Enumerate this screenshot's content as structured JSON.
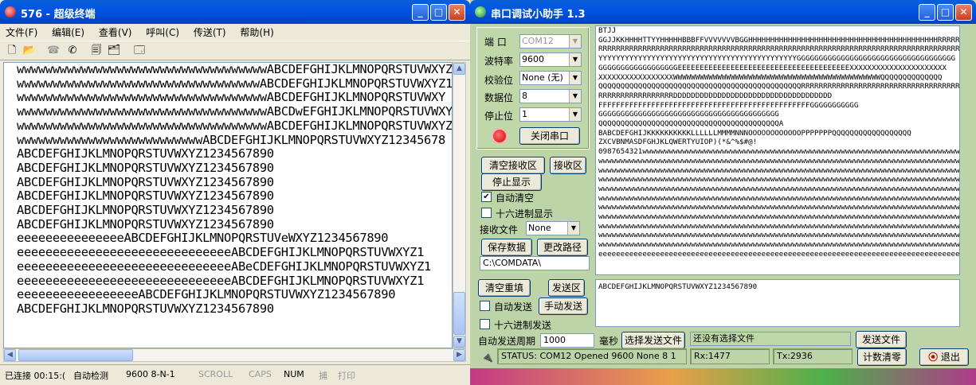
{
  "terminal": {
    "title": "576 - 超级终端",
    "menu": [
      "文件(F)",
      "编辑(E)",
      "查看(V)",
      "呼叫(C)",
      "传送(T)",
      "帮助(H)"
    ],
    "lines": [
      "wwwwwwwwwwwwwwwwwwwwwwwwwwwwwwwwwwwABCDEFGHIJKLMNOPQRSTUVWXYZ",
      "wwwwwwwwwwwwwwwwwwwwwwwwwwwwwwwwwwABCDEFGHIJKLMNOPQRSTUVWXYZ1",
      "wwwwwwwwwwwwwwwwwwwwwwwwwwwwwwwwwwwABCDEFGHIJKLMNOPQRSTUVWXY",
      "wwwwwwwwwwwwwwwwwwwwwwwwwwwwwwwwwwwABCDwEFGHIJKLMNOPQRSTUVWXYZ1",
      "wwwwwwwwwwwwwwwwwwwwwwwwwwwwwwwwwwwABCDEFGHIJKLMNOPQRSTUVWXYZ",
      "wwwwwwwwwwwwwwwwwwwwwwwwwwABCDEFGHIJKLMNOPQRSTUVWXYZ12345678",
      "ABCDEFGHIJKLMNOPQRSTUVWXYZ1234567890",
      "ABCDEFGHIJKLMNOPQRSTUVWXYZ1234567890",
      "ABCDEFGHIJKLMNOPQRSTUVWXYZ1234567890",
      "ABCDEFGHIJKLMNOPQRSTUVWXYZ1234567890",
      "ABCDEFGHIJKLMNOPQRSTUVWXYZ1234567890",
      "ABCDEFGHIJKLMNOPQRSTUVWXYZ1234567890",
      "eeeeeeeeeeeeeeeABCDEFGHIJKLMNOPQRSTUVeWXYZ1234567890",
      "eeeeeeeeeeeeeeeeeeeeeeeeeeeeeeABCDEFGHIJKLMNOPQRSTUVWXYZ1",
      "eeeeeeeeeeeeeeeeeeeeeeeeeeeeeeABeCDEFGHIJKLMNOPQRSTUVWXYZ1",
      "eeeeeeeeeeeeeeeeeeeeeeeeeeeeeeABCDEFGHIJKLMNOPQRSTUVWXYZ1",
      "eeeeeeeeeeeeeeeeeABCDEFGHIJKLMNOPQRSTUVWXYZ1234567890",
      "ABCDEFGHIJKLMNOPQRSTUVWXYZ1234567890"
    ],
    "status": {
      "connected": "已连接 00:15:(",
      "detect": "自动检测",
      "params": "9600 8-N-1",
      "scroll": "SCROLL",
      "caps": "CAPS",
      "num": "NUM",
      "capture": "捕",
      "print": "打印"
    }
  },
  "serial": {
    "title": "串口调试小助手 1.3",
    "port_label": "端  口",
    "port_value": "COM12",
    "baud_label": "波特率",
    "baud_value": "9600",
    "parity_label": "校验位",
    "parity_value": "None (无)",
    "databits_label": "数据位",
    "databits_value": "8",
    "stopbits_label": "停止位",
    "stopbits_value": "1",
    "close_port": "关闭串口",
    "clear_recv": "清空接收区",
    "recv_area": "接收区",
    "stop_display": "停止显示",
    "auto_clear": "自动清空",
    "hex_display": "十六进制显示",
    "recv_file_label": "接收文件",
    "recv_file_value": "None",
    "save_data": "保存数据",
    "change_path": "更改路径",
    "path": "C:\\COMDATA\\",
    "recv_lines": [
      "BTJJ",
      "GGJJKKHHHHTTYYHHHHHBBBFFVVVVVVVBGGHHHHHHHHHHHHHHHHHHHHHHHHHHHHHHHHHHHHHHHHHHHRRRRRR",
      "RRRRRRRRRRRRRRRRRRRRRRRRRRRRRRRRRRRRRRRRRRRRRRRRRRRRRRRRRRRRRRRRRRRRRRRRRRRRRRRRRRRY",
      "YYYYYYYYYYYYYYYYYYYYYYYYYYYYYYYYYYYYYYYYYYYYYGGGGGGGGGGGGGGGGGGGGGGGGGGGGGGGGGGGG",
      "GGGGGGGGGGGGGGGGGGEEEEEEEEEEEEEEEEEEEEEEEEEEEEEEEEEEEEEEEXXXXXXXXXXXXXXXXXXXXXX",
      "XXXXXXXXXXXXXXXXXWWWWWWWWWWWWWWWWWWWWWWWWWWWWWWWWWWWWWWWWWWWWWWWQQQQQQQQQQQQQQ",
      "QQQQQQQQQQQQQQQQQQQQQQQQQQQQQQQQQQQQQQQQQQQQQQRRRRRRRRRRRRRRRRRRRRRRRRRRRRRRRRRRRR",
      "RRRRRRRRRRRRRRRRRDDDDDDDDDDDDDDDDDDDDDDDDDDDDDDDDDDDD",
      "FFFFFFFFFFFFFFFFFFFFFFFFFFFFFFFFFFFFFFFFFFFFFFFFGGGGGGGGGGG",
      "GGGGGGGGGGGGGGGGGGGGGGGGGGGGGGGGGGGGGGGGG",
      "QQQQQQQQQQQQQQQQQQQQQQQQQQQQQQQQQQQQQQQQQA",
      "BABCDEFGHIJKKKKKKKKKKLLLLLLMMMMNNNOOOOOOOOOOOOPPPPPPPQQQQQQQQQQQQQQQQQQ",
      "ZXCVBNMASDFGHJKLQWERTYUIOP)(*&^%$#@!",
      "0987654321wwwwwwwwwwwwwwwwwwwwwwwwwwwwwwwwwwwwwwwwwwwwwwwwwwwwwwwwwwwwwwwwwwwwwwww",
      "wwwwwwwwwwwwwwwwwwwwwwwwwwwwwwwwwwwwwwwwwwwwwwwwwwwwwwwwwwwwwwwwwwwwwwwwwwwwwwwwwwww",
      "wwwwwwwwwwwwwwwwwwwwwwwwwwwwwwwwwwwwwwwwwwwwwwwwwwwwwwwwwwwwwwwwwwwwwwwwwwwwwwwwwwww",
      "wwwwwwwwwwwwwwwwwwwwwwwwwwwwwwwwwwwwwwwwwwwwwwwwwwwwwwwwwwwwwwwwwwwwwwwwwwwwwwwwwwww",
      "wwwwwwwwwwwwwwwwwwwwwwwwwwwwwwwwwwwwwwwwwwwwwwwwwwwwwwwwwwwwwwwwwwwwwwwwwwwwwwwwwwww",
      "wwwwwwwwwwwwwwwwwwwwwwwwwwwwwwwwwwwwwwwwwwwwwwwwwwwwwwwwwwwwwwwwwwwwwwwwwwwwwwwwwwww",
      "wwwwwwwwwwwwwwwwwwwwwwwwwwwwwwwwwwwwwwwwwwwwwwwwwwwwwwwwwwwwwwwwwwwwwwwwwwwwwwwwwwww",
      "wwwwwwwwwwwwwwwwwwwwwwwwwwwwwwwwwwwwwwwwwwwwwwwwwwwwwwwwwwwwwwwwwwwwwwwwwwwwwwwwwwww",
      "wwwwwwwwwwwwwwwwwwwwwwwwwwwwwwwwwwwwwwwwwwwwwwwwwwwwwwwwwwwwwwwwwwwwwwwwwwwwwwwwwwww",
      "wwwwwwwwwwwwwwwwwwwwwwwwwwwwwwwwwwwwwwwwwwwwwwwwwwwwwwwwwwwwwwwwwwwwwwwwwwwwwwwwwwww",
      "wwwwwwwwwwwwwwwwwwwwwwwwwwwwwwwwwwwwwwwwwwwwwwwwwwwwwwwwwwwwwwwwwwwwwwwwwwwwwwwwwwww",
      "eeeeeeeeeeeeeeeeeeeeeeeeeeeeeeeeeeeeeeeeeeeeeeeeeeeeeeeeeeeeeeeeeeeeeeeeeeeeeeeeeeee"
    ],
    "clear_send": "清空重填",
    "send_area": "发送区",
    "send_text": "ABCDEFGHIJKLMNOPQRSTUVWXYZ1234567890",
    "auto_send": "自动发送",
    "manual_send": "手动发送",
    "hex_send": "十六进制发送",
    "period_label": "自动发送周期",
    "period_value": "1000",
    "ms": "毫秒",
    "choose_file": "选择发送文件",
    "no_file": "还没有选择文件",
    "send_file": "发送文件",
    "status_text": "STATUS: COM12 Opened 9600 None  8 1",
    "rx": "Rx:1477",
    "tx": "Tx:2936",
    "count_clear": "计数清零",
    "exit": "退出"
  }
}
